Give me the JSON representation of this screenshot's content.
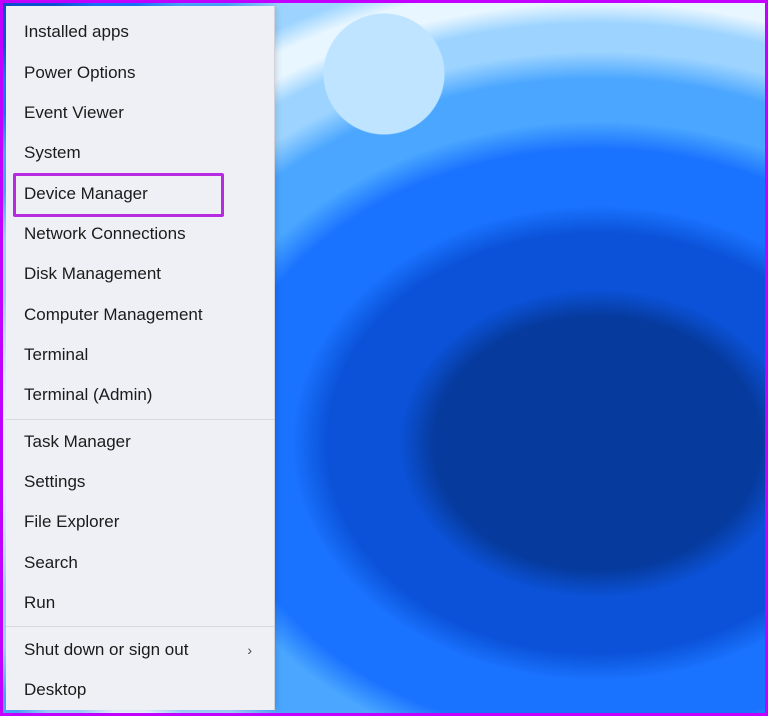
{
  "highlight_color": "#b62be0",
  "border_color": "#c300ff",
  "menu": {
    "group1": [
      {
        "id": "installed-apps",
        "label": "Installed apps"
      },
      {
        "id": "power-options",
        "label": "Power Options"
      },
      {
        "id": "event-viewer",
        "label": "Event Viewer"
      },
      {
        "id": "system",
        "label": "System"
      },
      {
        "id": "device-manager",
        "label": "Device Manager",
        "highlighted": true
      },
      {
        "id": "network-connections",
        "label": "Network Connections"
      },
      {
        "id": "disk-management",
        "label": "Disk Management"
      },
      {
        "id": "computer-management",
        "label": "Computer Management"
      },
      {
        "id": "terminal",
        "label": "Terminal"
      },
      {
        "id": "terminal-admin",
        "label": "Terminal (Admin)"
      }
    ],
    "group2": [
      {
        "id": "task-manager",
        "label": "Task Manager"
      },
      {
        "id": "settings",
        "label": "Settings"
      },
      {
        "id": "file-explorer",
        "label": "File Explorer"
      },
      {
        "id": "search",
        "label": "Search"
      },
      {
        "id": "run",
        "label": "Run"
      }
    ],
    "group3": [
      {
        "id": "shutdown",
        "label": "Shut down or sign out",
        "submenu": true
      },
      {
        "id": "desktop",
        "label": "Desktop"
      }
    ]
  },
  "chevron_glyph": "›"
}
